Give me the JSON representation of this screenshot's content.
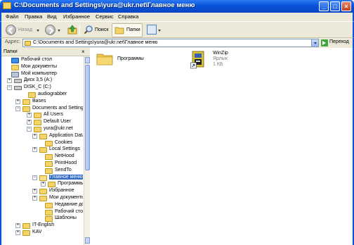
{
  "window": {
    "title": "C:\\Documents and Settings\\yura@ukr.net\\Главное меню"
  },
  "menu": [
    "Файл",
    "Правка",
    "Вид",
    "Избранное",
    "Сервис",
    "Справка"
  ],
  "toolbar": {
    "back_label": "Назад",
    "search_label": "Поиск",
    "folders_label": "Папки"
  },
  "address": {
    "label": "Адрес:",
    "value": "C:\\Documents and Settings\\yura@ukr.net\\Главное меню",
    "go_label": "Переход"
  },
  "left_pane": {
    "title": "Папки"
  },
  "tree": [
    {
      "label": "Рабочий стол",
      "expander": ""
    },
    {
      "label": "Мои документы",
      "expander": ""
    },
    {
      "label": "Мой компьютер",
      "expander": ""
    },
    {
      "label": "Диск 3,5 (A:)",
      "expander": "+"
    },
    {
      "label": "DISK_C (C:)",
      "expander": "−"
    },
    {
      "label": "audiograbber",
      "expander": ""
    },
    {
      "label": "Bases",
      "expander": "+"
    },
    {
      "label": "Documents and Settings",
      "expander": "−"
    },
    {
      "label": "All Users",
      "expander": "+"
    },
    {
      "label": "Default User",
      "expander": "+"
    },
    {
      "label": "yura@ukr.net",
      "expander": "−"
    },
    {
      "label": "Application Data",
      "expander": "+"
    },
    {
      "label": "Cookies",
      "expander": ""
    },
    {
      "label": "Local Settings",
      "expander": "+"
    },
    {
      "label": "NetHood",
      "expander": ""
    },
    {
      "label": "PrintHood",
      "expander": ""
    },
    {
      "label": "SendTo",
      "expander": ""
    },
    {
      "label": "Главное меню",
      "expander": "−"
    },
    {
      "label": "Программы",
      "expander": "+"
    },
    {
      "label": "Избранное",
      "expander": "+"
    },
    {
      "label": "Мои документы",
      "expander": "+"
    },
    {
      "label": "Недавние докум",
      "expander": ""
    },
    {
      "label": "Рабочий стол",
      "expander": ""
    },
    {
      "label": "Шаблоны",
      "expander": ""
    },
    {
      "label": "IT-English",
      "expander": "+"
    },
    {
      "label": "KAV",
      "expander": "+"
    }
  ],
  "files": [
    {
      "name": "Программы",
      "icon": "folder-icon"
    },
    {
      "name": "WinZip",
      "type": "Ярлык",
      "size": "1 КБ",
      "icon": "winzip-icon"
    }
  ]
}
